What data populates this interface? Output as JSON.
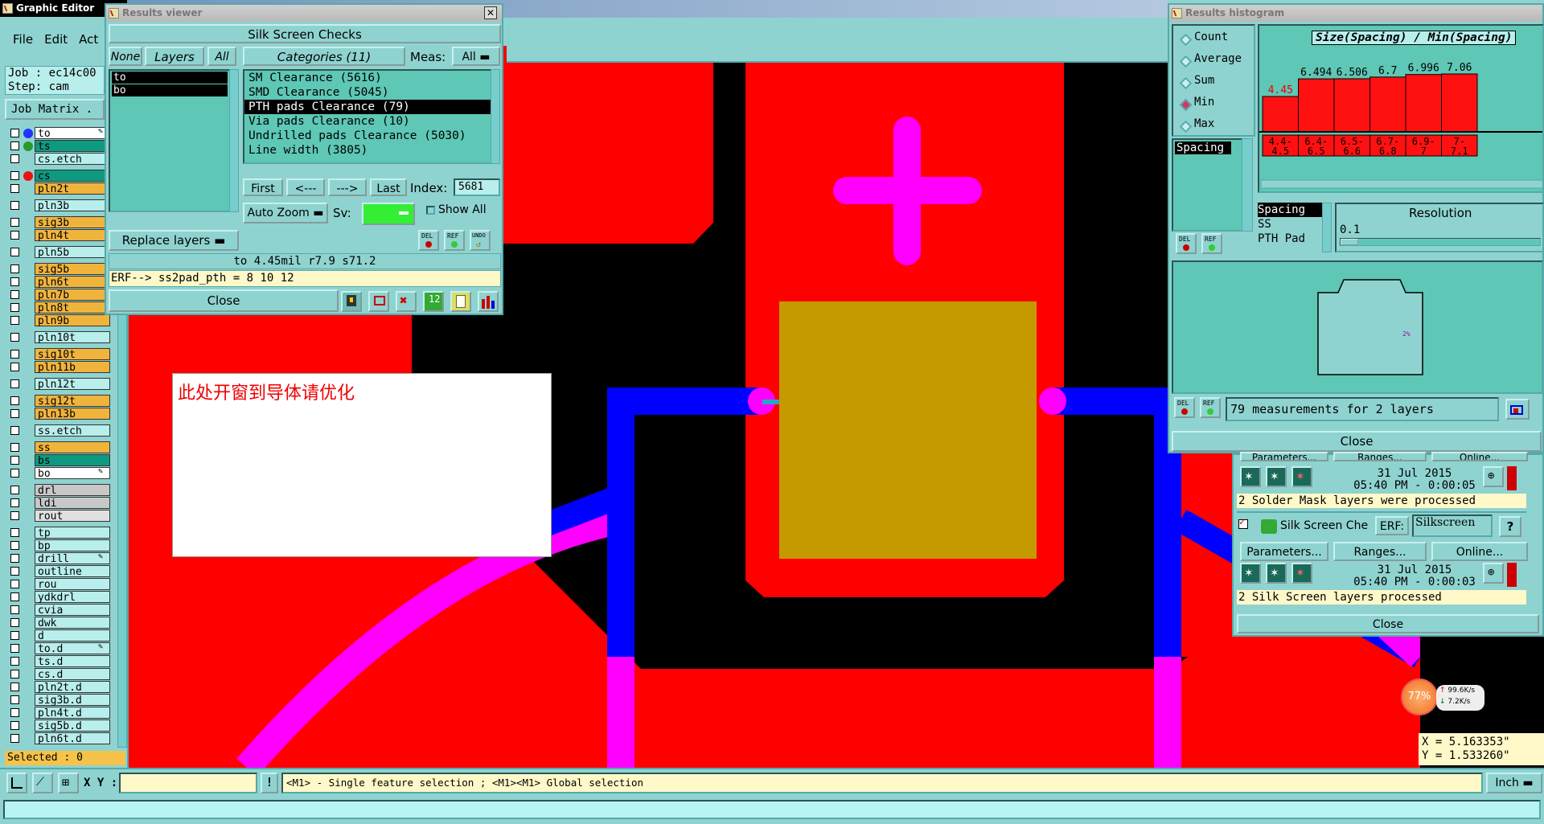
{
  "colors": {
    "accent": "#ff0000",
    "window_bg": "#8fd3d0",
    "magenta": "#ff00ff",
    "blue": "#0000ff",
    "pad": "#c49a00"
  },
  "graphic_editor": {
    "title": "Graphic Editor",
    "menu": [
      "File",
      "Edit",
      "Act"
    ],
    "job": "Job : ec14c00",
    "step": "Step: cam",
    "job_matrix": "Job Matrix .",
    "selected": "Selected : 0"
  },
  "layers": [
    {
      "name": "to",
      "color": "#ffffff",
      "dot": "#2233ff",
      "has_dot": true,
      "pen": true
    },
    {
      "name": "ts",
      "color": "#0e9a80",
      "dot": "#2a9a2a",
      "has_dot": true
    },
    {
      "name": "cs.etch",
      "color": "#b8eeec"
    },
    {
      "name": "cs",
      "color": "#0e9a80",
      "dot": "#ee1111",
      "has_dot": true
    },
    {
      "name": "pln2t",
      "color": "#f0b43c"
    },
    {
      "name": "pln3b",
      "color": "#b8eeec"
    },
    {
      "name": "sig3b",
      "color": "#f0b43c"
    },
    {
      "name": "pln4t",
      "color": "#f0b43c"
    },
    {
      "name": "pln5b",
      "color": "#b8eeec"
    },
    {
      "name": "sig5b",
      "color": "#f0b43c"
    },
    {
      "name": "pln6t",
      "color": "#f0b43c"
    },
    {
      "name": "pln7b",
      "color": "#f0b43c"
    },
    {
      "name": "pln8t",
      "color": "#f0b43c"
    },
    {
      "name": "pln9b",
      "color": "#f0b43c"
    },
    {
      "name": "pln10t",
      "color": "#b8eeec"
    },
    {
      "name": "sig10t",
      "color": "#f0b43c"
    },
    {
      "name": "pln11b",
      "color": "#f0b43c"
    },
    {
      "name": "pln12t",
      "color": "#b8eeec"
    },
    {
      "name": "sig12t",
      "color": "#f0b43c"
    },
    {
      "name": "pln13b",
      "color": "#f0b43c"
    },
    {
      "name": "ss.etch",
      "color": "#b8eeec"
    },
    {
      "name": "ss",
      "color": "#f0b43c"
    },
    {
      "name": "bs",
      "color": "#0e9a80"
    },
    {
      "name": "bo",
      "color": "#ffffff",
      "pen": true
    },
    {
      "name": "drl",
      "color": "#c8c8c8"
    },
    {
      "name": "ldi",
      "color": "#c8c8c8"
    },
    {
      "name": "rout",
      "color": "#e0e0e0"
    },
    {
      "name": "tp",
      "color": "#b8eeec"
    },
    {
      "name": "bp",
      "color": "#b8eeec"
    },
    {
      "name": "drill",
      "color": "#b8eeec",
      "pen": true
    },
    {
      "name": "outline",
      "color": "#b8eeec"
    },
    {
      "name": "rou",
      "color": "#b8eeec"
    },
    {
      "name": "ydkdrl",
      "color": "#b8eeec"
    },
    {
      "name": "cvia",
      "color": "#b8eeec"
    },
    {
      "name": "dwk",
      "color": "#b8eeec"
    },
    {
      "name": "d",
      "color": "#b8eeec"
    },
    {
      "name": "to.d",
      "color": "#b8eeec",
      "pen": true
    },
    {
      "name": "ts.d",
      "color": "#b8eeec"
    },
    {
      "name": "cs.d",
      "color": "#b8eeec"
    },
    {
      "name": "pln2t.d",
      "color": "#b8eeec"
    },
    {
      "name": "sig3b.d",
      "color": "#b8eeec"
    },
    {
      "name": "pln4t.d",
      "color": "#b8eeec"
    },
    {
      "name": "sig5b.d",
      "color": "#b8eeec"
    },
    {
      "name": "pln6t.d",
      "color": "#b8eeec"
    }
  ],
  "results_viewer": {
    "title": "Results viewer",
    "header": "Silk Screen Checks",
    "none": "None",
    "layers_label": "Layers",
    "all": "All",
    "categories_label": "Categories (11)",
    "meas_label": "Meas:",
    "meas_value": "All",
    "layer_list": [
      "to",
      "bo"
    ],
    "categories": [
      "SM Clearance (5616)",
      "SMD Clearance (5045)",
      "PTH pads Clearance (79)",
      "Via pads Clearance (10)",
      "Undrilled pads Clearance (5030)",
      "Line width (3805)"
    ],
    "first": "First",
    "prev": "<---",
    "next": "--->",
    "last": "Last",
    "index_label": "Index:",
    "index_value": "5681",
    "auto_zoom": "Auto Zoom",
    "sv": "Sv:",
    "show_all": "Show All",
    "replace_layers": "Replace layers",
    "status1": "to 4.45mil  r7.9  s71.2",
    "status2": "ERF--> ss2pad_pth = 8 10 12",
    "close": "Close",
    "del": "DEL",
    "ref": "REF",
    "undo": "UNDO"
  },
  "note": "此处开窗到导体请优化",
  "histogram": {
    "title": "Results histogram",
    "options": [
      "Count",
      "Average",
      "Sum",
      "Min",
      "Max"
    ],
    "selected": "Min",
    "chart_title": "Size(Spacing) / Min(Spacing)",
    "attr_list": [
      "Spacing"
    ],
    "res_list": [
      "Spacing",
      "SS",
      "PTH Pad"
    ],
    "resolution_label": "Resolution",
    "resolution_value": "0.1",
    "summary": "79 measurements for 2 layers",
    "close": "Close",
    "del": "DEL",
    "ref": "REF"
  },
  "chart_data": {
    "type": "bar",
    "title": "Size(Spacing) / Min(Spacing)",
    "categories": [
      "4.4-4.5",
      "6.4-6.5",
      "6.5-6.6",
      "6.7-6.8",
      "6.9-7",
      "7-7.1"
    ],
    "values": [
      4.45,
      6.494,
      6.506,
      6.7,
      6.996,
      7.06
    ],
    "value_labels": [
      "4.45",
      "6.494",
      "6.506",
      "6.7",
      "6.996",
      "7.06"
    ],
    "cat_line1": [
      "4.4-",
      "6.4-",
      "6.5-",
      "6.7-",
      "6.9-",
      "7-"
    ],
    "cat_line2": [
      "4.5",
      "6.5",
      "6.6",
      "6.8",
      "7",
      "7.1"
    ],
    "highlight_color": "#ee0000",
    "bar_color": "#ff1111"
  },
  "checklist": {
    "params": "Parameters...",
    "ranges": "Ranges...",
    "online": "Online...",
    "date1": "31 Jul 2015",
    "time1": "05:40 PM - 0:00:05",
    "msg1": "2 Solder Mask layers were processed",
    "check_name": "Silk Screen Che",
    "erf": "ERF:",
    "erf_value": "Silkscreen",
    "date2": "31 Jul 2015",
    "time2": "05:40 PM - 0:00:03",
    "msg2": "2 Silk Screen layers processed",
    "close": "Close",
    "help": "?"
  },
  "net": {
    "percent": "77%",
    "up": "99.6K/s",
    "down": "7.2K/s"
  },
  "coords": {
    "x": "X = 5.163353\"",
    "y": "Y = 1.533260\""
  },
  "bottom": {
    "xy_label": "X Y :",
    "xy_value": "",
    "excl": "!",
    "hint": "<M1> - Single feature selection ; <M1><M1> Global selection",
    "units": "Inch"
  }
}
